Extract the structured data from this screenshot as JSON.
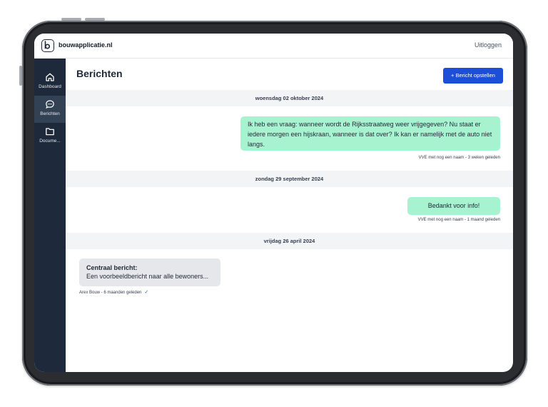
{
  "app": {
    "brand": "bouwapplicatie.nl",
    "logout_label": "Uitloggen"
  },
  "sidebar": {
    "items": [
      {
        "label": "Dashboard",
        "icon": "home-icon",
        "active": false
      },
      {
        "label": "Berichten",
        "icon": "chat-bubble-icon",
        "active": true
      },
      {
        "label": "Docume...",
        "icon": "folder-icon",
        "active": false
      }
    ]
  },
  "main": {
    "title": "Berichten",
    "compose_label": "+ Bericht opstellen",
    "groups": [
      {
        "date": "woensdag 02 oktober 2024",
        "message": {
          "text": "Ik heb een vraag: wanneer wordt de Rijksstraatweg weer vrijgegeven? Nu staat er iedere morgen een hijskraan, wanneer is dat over? Ik kan er namelijk met de auto niet langs.",
          "meta": "VVE met nog een naam - 3 weken geleden",
          "own": true
        }
      },
      {
        "date": "zondag 29 september 2024",
        "message": {
          "text": "Bedankt voor info!",
          "meta": "VVE met nog een naam - 1 maand geleden",
          "own": true
        }
      },
      {
        "date": "vrijdag 26 april 2024",
        "message": {
          "title": "Centraal bericht:",
          "text": "Een voorbeeldbericht naar alle bewoners...",
          "meta": "Arex Bouw - 6 maanden geleden",
          "read_mark": "✓",
          "own": false
        }
      }
    ]
  },
  "colors": {
    "sidebar": "#1e293b",
    "accent": "#1d4ed8",
    "own_bubble": "#a7f3d0",
    "other_bubble": "#e5e7eb",
    "date_bar": "#f3f4f6"
  }
}
